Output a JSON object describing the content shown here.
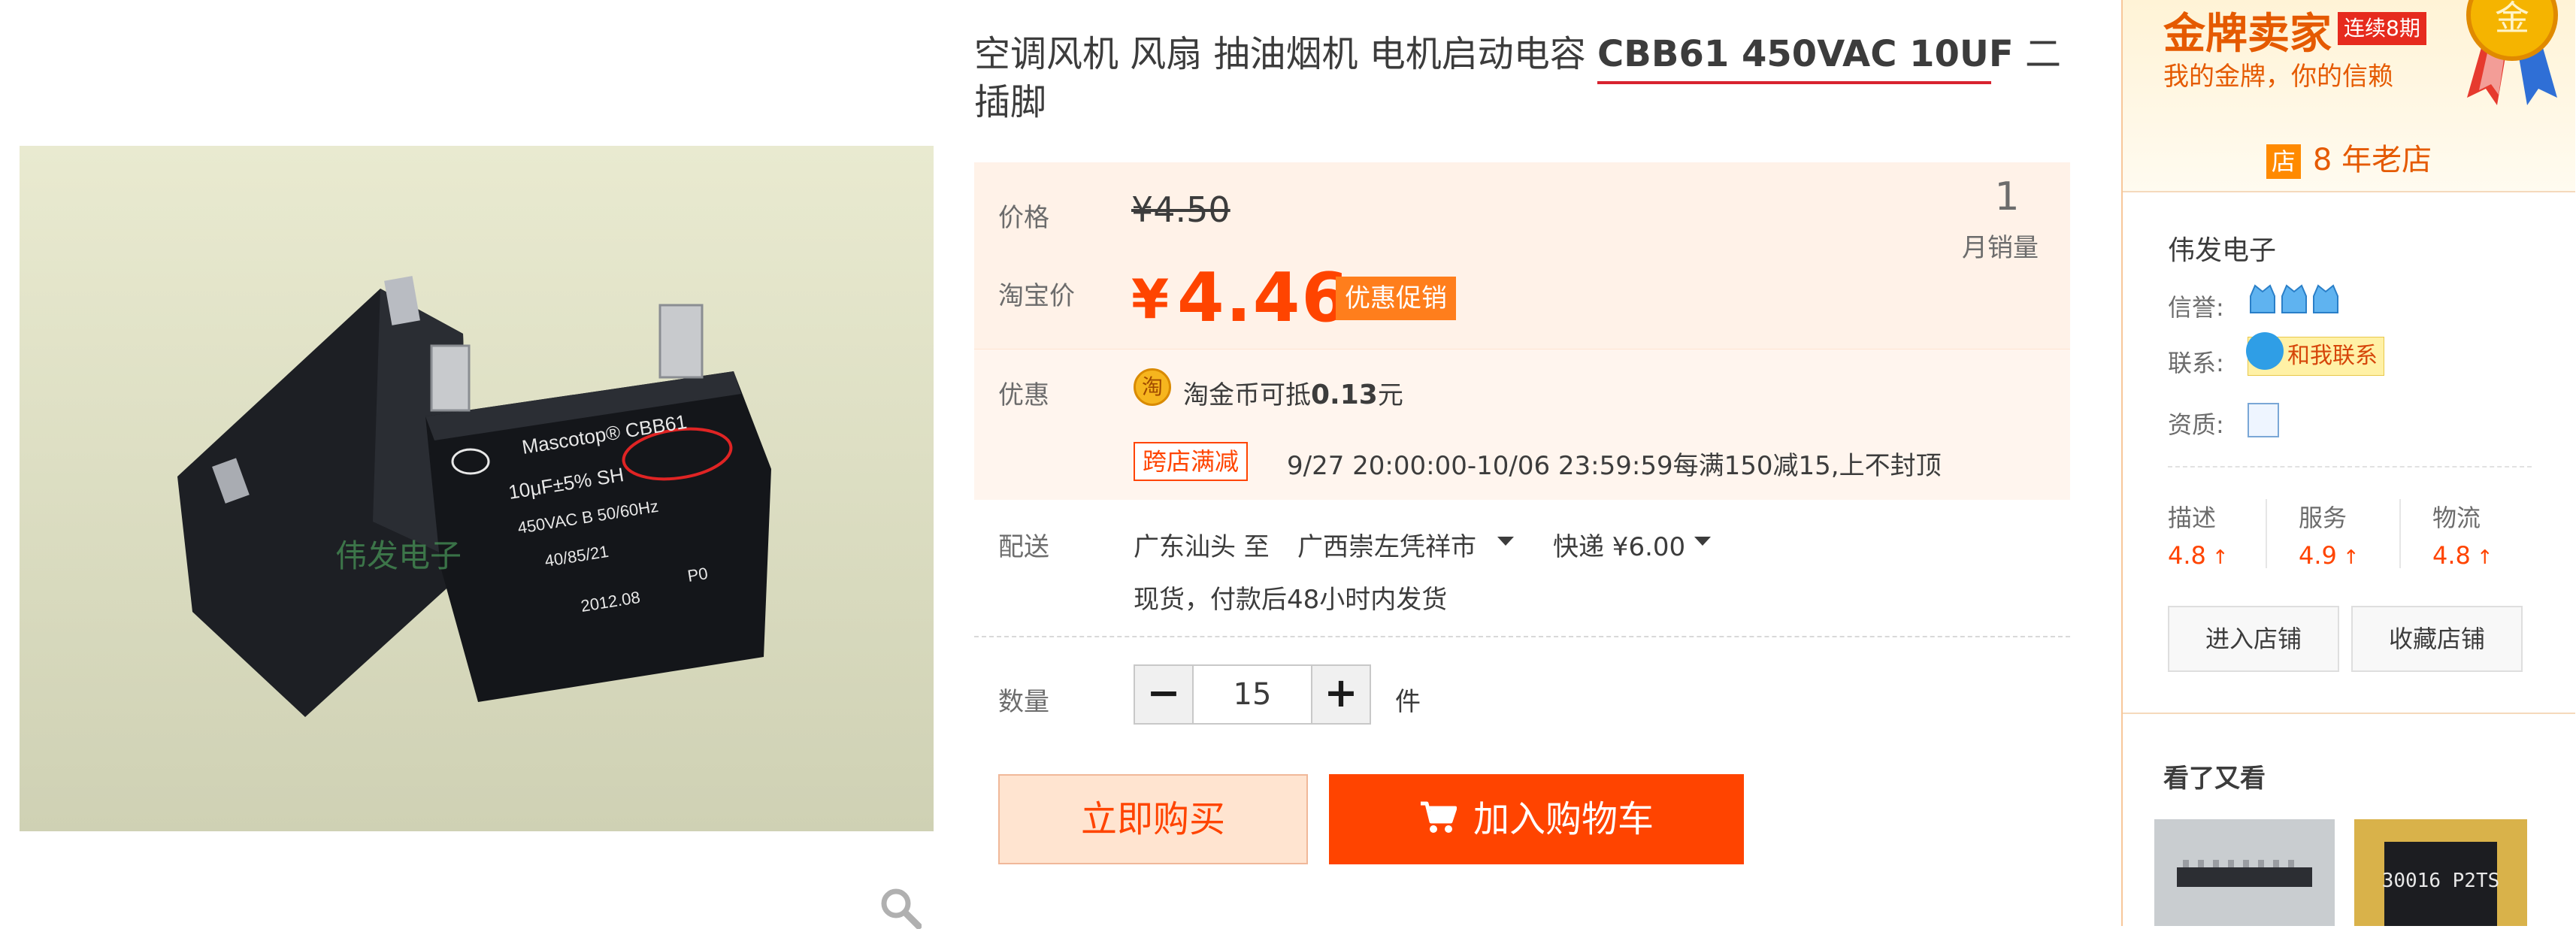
{
  "product": {
    "title_prefix": "空调风机 风扇 抽油烟机 电机启动电容 ",
    "title_model": "CBB61 450VAC 10UF",
    "title_suffix": " 二插脚"
  },
  "photo": {
    "watermark": "伟发电子",
    "zoom_icon": "magnifier-icon"
  },
  "price": {
    "label": "价格",
    "original": "¥4.50",
    "taobao_label": "淘宝价",
    "currency": "¥",
    "value": "4.46",
    "promo_tag": "优惠促销",
    "monthly_sales_value": "1",
    "monthly_sales_label": "月销量"
  },
  "discount": {
    "label": "优惠",
    "coin_icon": "淘",
    "coin_prefix": "淘金币可抵",
    "coin_amount": "0.13",
    "coin_suffix": "元",
    "cross_store_tag": "跨店满减",
    "cross_store_text": "9/27 20:00:00-10/06 23:59:59每满150减15,上不封顶"
  },
  "shipping": {
    "label": "配送",
    "from": "广东汕头 至",
    "to": "广西崇左凭祥市",
    "method": "快递 ¥6.00",
    "note": "现货，付款后48小时内发货"
  },
  "quantity": {
    "label": "数量",
    "minus": "−",
    "value": "15",
    "plus": "+",
    "unit": "件"
  },
  "actions": {
    "buy_now": "立即购买",
    "add_to_cart": "加入购物车"
  },
  "sidebar": {
    "gold_title": "金牌卖家",
    "gold_badge": "连续8期",
    "gold_slogan": "我的金牌，你的信赖",
    "medal_text": "金",
    "store_icon": "店",
    "store_years": "8 年老店",
    "shop_name": "伟发电子",
    "reputation_label": "信誉:",
    "contact_label": "联系:",
    "contact_button": "和我联系",
    "qualification_label": "资质:",
    "scores": [
      {
        "label": "描述",
        "value": "4.8"
      },
      {
        "label": "服务",
        "value": "4.9"
      },
      {
        "label": "物流",
        "value": "4.8"
      }
    ],
    "score_arrow": "↑",
    "enter_shop": "进入店铺",
    "favorite_shop": "收藏店铺",
    "also_viewed_title": "看了又看",
    "thumb2_text": "30016 P2TS"
  },
  "colors": {
    "accent": "#ff4400",
    "price_bg": "#fff2e8",
    "gold": "#e55a00"
  }
}
